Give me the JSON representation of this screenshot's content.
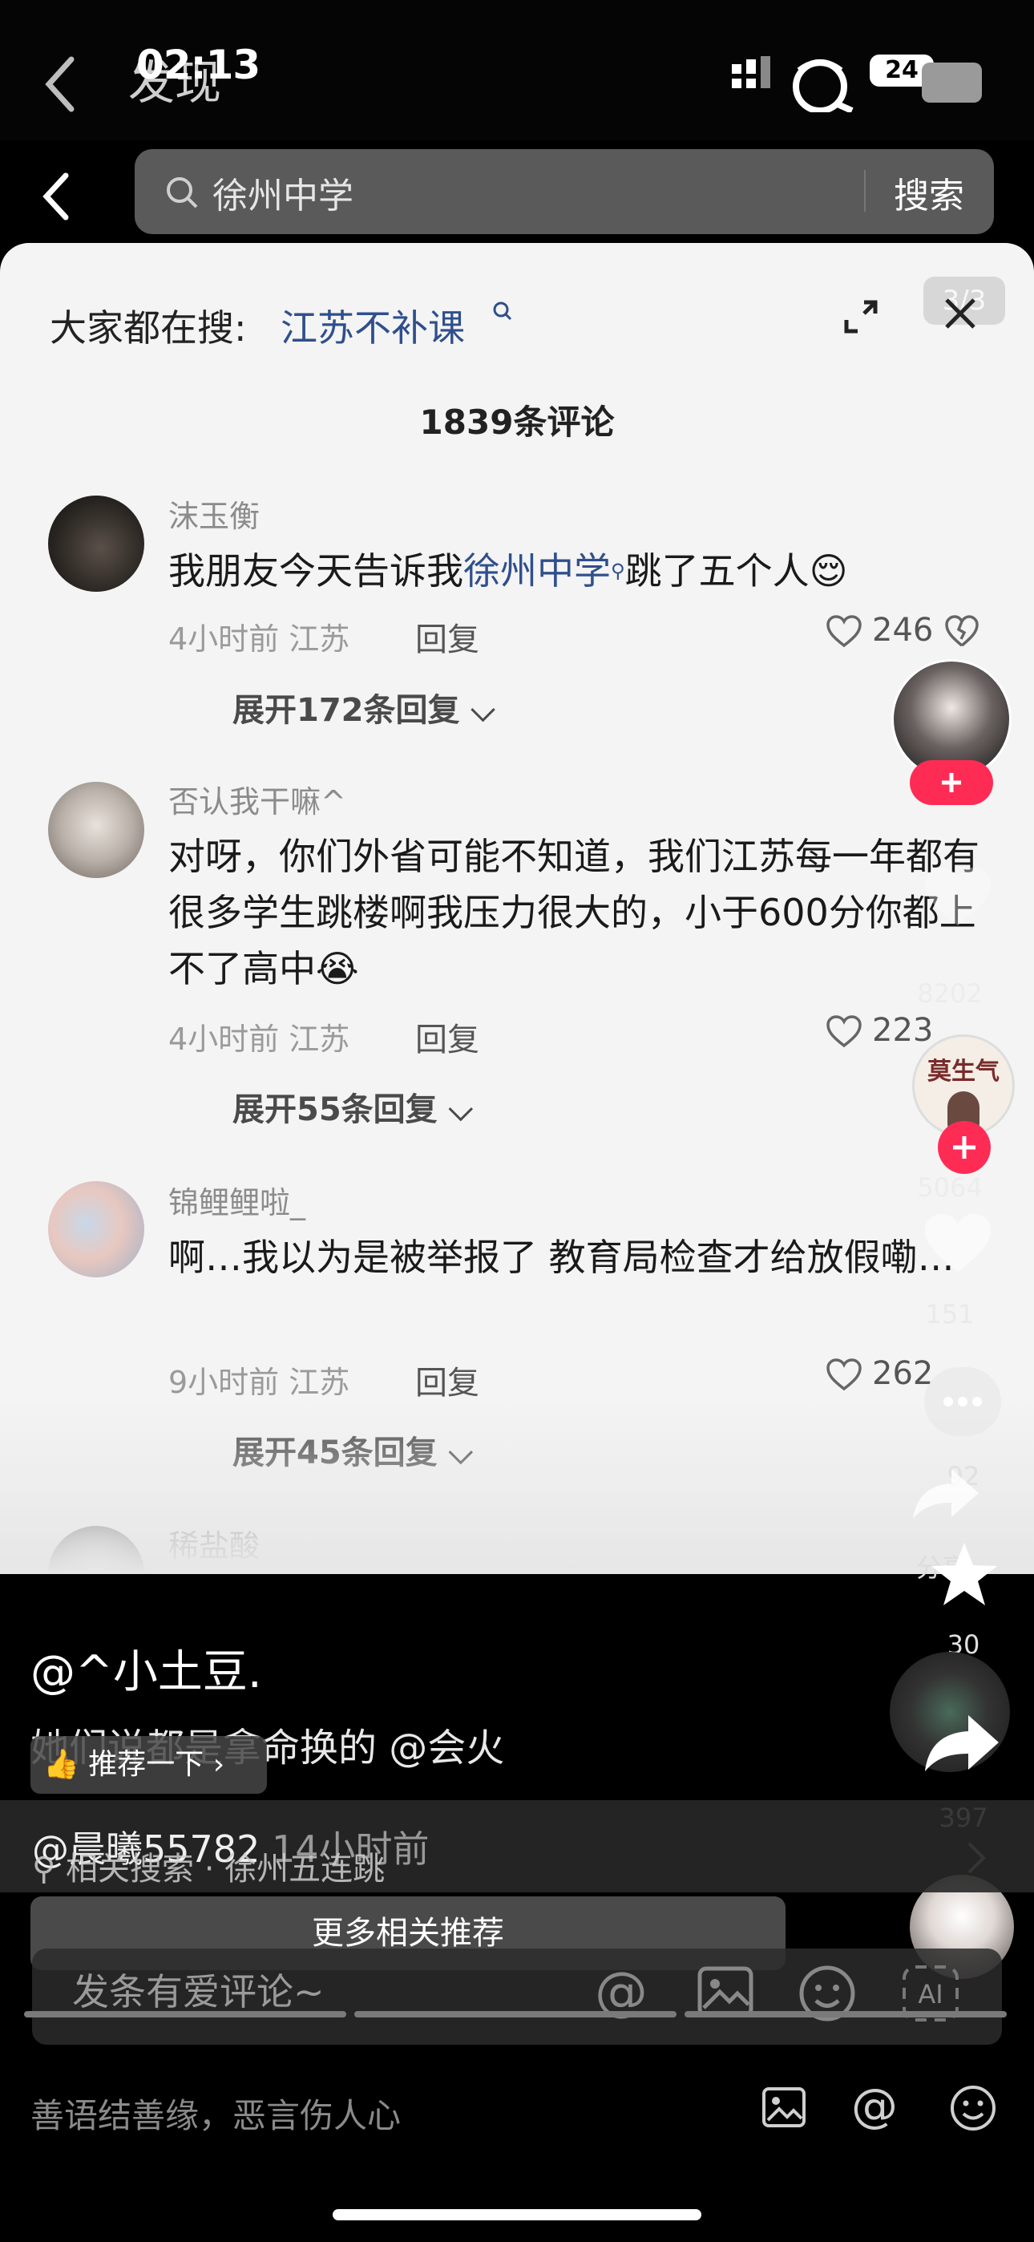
{
  "status": {
    "time": "02:13",
    "battery": "24"
  },
  "nav": {
    "title": "发现"
  },
  "search": {
    "query": "徐州中学",
    "button": "搜索"
  },
  "sheet": {
    "hot_label": "大家都在搜:",
    "hot_link": "江苏不补课",
    "page_badge": "3/3",
    "count_title": "1839条评论",
    "reply_label": "回复",
    "comments": [
      {
        "user": "沫玉衡",
        "text_before": "我朋友今天告诉我",
        "text_link": "徐州中学",
        "text_after": "跳了五个人",
        "emoji": "😌",
        "time": "4小时前",
        "location": "江苏",
        "likes": "246",
        "expand": "展开172条回复"
      },
      {
        "user": "否认我干嘛^",
        "text": "对呀，你们外省可能不知道，我们江苏每一年都有很多学生跳楼啊我压力很大的，小于600分你都上不了高中",
        "emoji": "😭",
        "time": "4小时前",
        "location": "江苏",
        "likes": "223",
        "expand": "展开55条回复"
      },
      {
        "user": "锦鲤鲤啦_",
        "text": "啊…我以为是被举报了 教育局检查才给放假嘞…",
        "time": "9小时前",
        "location": "江苏",
        "likes": "262",
        "expand": "展开45条回复"
      },
      {
        "user": "稀盐酸"
      }
    ]
  },
  "rail": {
    "counts": [
      "8202",
      "5064",
      "151",
      "92",
      "30",
      "397"
    ],
    "share_label": "分享",
    "badge_text": "莫生气"
  },
  "video": {
    "author": "@^小土豆.",
    "caption": "她们说都是拿命换的 @会火",
    "recommend": "推荐一下",
    "related_user": "@晨曦55782",
    "related_time": "14小时前",
    "related_search_label": "相关搜索",
    "related_search_term": "徐州五连跳",
    "more_rec": "更多相关推荐",
    "comment_placeholder": "发条有爱评论~",
    "bottom_placeholder": "善语结善缘，恶言伤人心"
  },
  "colors": {
    "link": "#2f4f8c",
    "accent": "#fe2c55",
    "sheet_bg": "#f4f4f4"
  }
}
